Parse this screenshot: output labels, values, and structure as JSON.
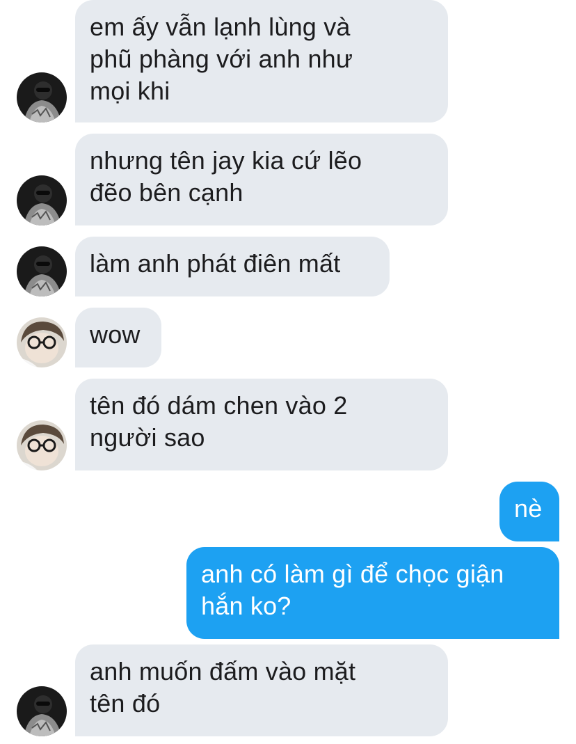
{
  "conversation": {
    "messages": [
      {
        "sender": "other",
        "avatar": "dark-avatar",
        "text": "em ấy vẫn lạnh lùng và\nphũ phàng với anh như\nmọi khi"
      },
      {
        "sender": "other",
        "avatar": "dark-avatar",
        "text": "nhưng tên jay kia cứ lẽo\nđẽo bên cạnh"
      },
      {
        "sender": "other",
        "avatar": "dark-avatar",
        "text": "làm anh phát điên mất"
      },
      {
        "sender": "other",
        "avatar": "glasses-avatar",
        "text": "wow"
      },
      {
        "sender": "other",
        "avatar": "glasses-avatar",
        "text": "tên đó dám chen vào 2\nngười sao"
      },
      {
        "sender": "self",
        "text": "nè"
      },
      {
        "sender": "self",
        "text": "anh có làm gì để chọc giận\nhắn ko?"
      },
      {
        "sender": "other",
        "avatar": "dark-avatar",
        "text": "anh muốn đấm vào mặt\ntên đó"
      }
    ]
  },
  "colors": {
    "incoming_bubble": "#e6eaef",
    "outgoing_bubble": "#1da1f2",
    "incoming_text": "#1c1c1e",
    "outgoing_text": "#ffffff"
  }
}
